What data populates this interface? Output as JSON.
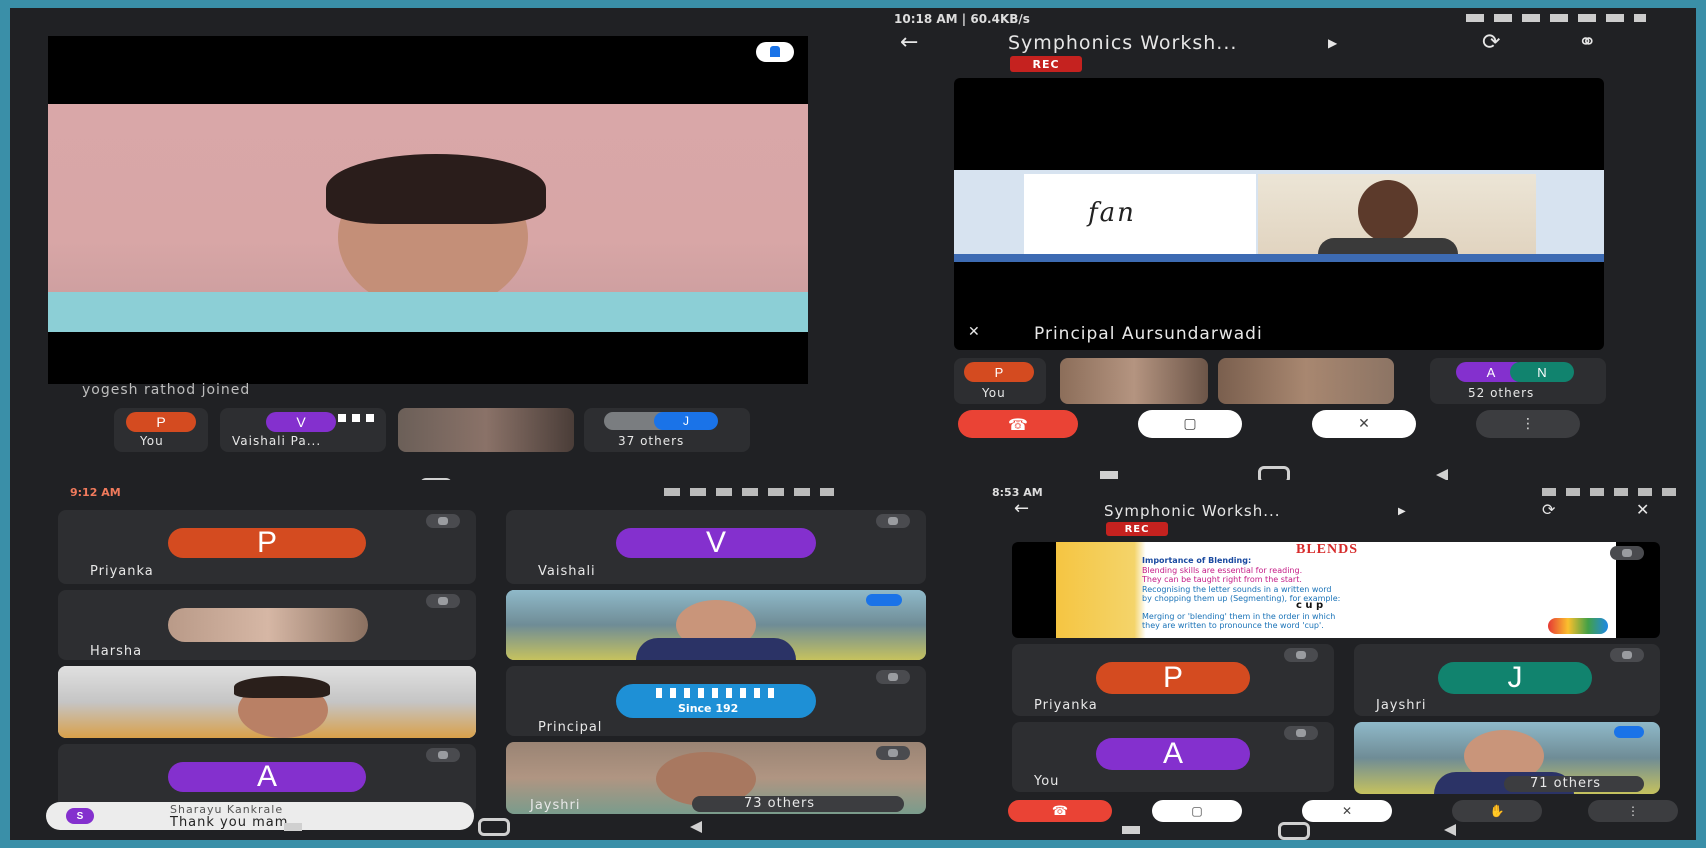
{
  "colors": {
    "frame": "#3a8fa8",
    "bg": "#202124",
    "tile": "#2d2e31",
    "orange": "#d44b20",
    "purple": "#8430ce",
    "blue": "#1a73e8",
    "teal": "#11836e",
    "red": "#ea4335"
  },
  "q1": {
    "joined_text": "yogesh rathod joined",
    "chips": [
      {
        "letter": "P",
        "label": "You"
      },
      {
        "letter": "V",
        "label": "Vaishali Pa..."
      },
      {
        "letter": "J",
        "label": "37 others"
      }
    ]
  },
  "q2": {
    "status_left": "10:18 AM | 60.4KB/s",
    "meeting_title": "Symphonics Worksh...",
    "rec": "REC",
    "slide_word": "fan",
    "presenter": "Principal Aursundarwadi",
    "chips": [
      {
        "letter": "P",
        "label": "You"
      },
      {
        "letters": [
          "A",
          "N"
        ],
        "label": "52 others"
      }
    ]
  },
  "q3": {
    "status_time": "9:12 AM",
    "tiles": [
      {
        "letter": "P",
        "name": "Priyanka"
      },
      {
        "letter": "V",
        "name": "Vaishali"
      },
      {
        "name": "Harsha"
      },
      {
        "name": "Principal",
        "logo_text": "Since 192"
      },
      {
        "letter": "A"
      },
      {
        "name": "Jayshri",
        "others": "73 others"
      }
    ],
    "toast_initial": "S",
    "toast_name": "Sharayu Kankrale",
    "toast_message": "Thank you mam"
  },
  "q4": {
    "status_time": "8:53 AM",
    "meeting_title": "Symphonic Worksh...",
    "rec": "REC",
    "slide_title": "BLENDS",
    "slide_lines": [
      "Importance of Blending:",
      "Blending skills are essential for reading.",
      "They can be taught right from the start.",
      "Recognising the letter sounds in a written word",
      "by chopping them up (Segmenting), for example:",
      "c u p",
      "Merging or 'blending' them in the order in which",
      "they are written to pronounce the word 'cup'."
    ],
    "tiles": [
      {
        "letter": "P",
        "name": "Priyanka"
      },
      {
        "letter": "J",
        "name": "Jayshri"
      },
      {
        "letter": "A",
        "name": "You"
      },
      {
        "others": "71 others"
      }
    ]
  }
}
